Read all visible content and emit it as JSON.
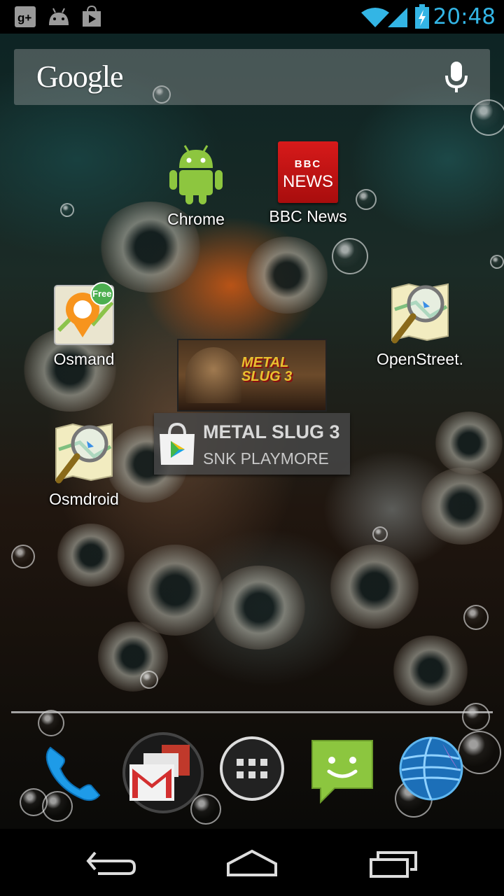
{
  "status_bar": {
    "time": "20:48",
    "left_icons": [
      "google-plus-icon",
      "android-debug-icon",
      "play-store-notification-icon"
    ],
    "right_icons": [
      "wifi-icon",
      "signal-icon",
      "battery-charging-icon"
    ],
    "accent_color": "#33b5e5"
  },
  "search": {
    "logo": "Google",
    "voice_icon": "mic-icon"
  },
  "apps": {
    "chrome": {
      "label": "Chrome",
      "icon": "android-robot-icon"
    },
    "bbc": {
      "label": "BBC News",
      "icon": "bbc-news-icon",
      "icon_top": "BBC",
      "icon_bottom": "NEWS"
    },
    "osmand": {
      "label": "Osmand",
      "icon": "osmand-map-icon",
      "badge": "Free"
    },
    "openstreet": {
      "label": "OpenStreet.",
      "icon": "map-magnifier-icon"
    },
    "osmdroid": {
      "label": "Osmdroid",
      "icon": "map-magnifier-icon"
    }
  },
  "play_widget": {
    "title": "METAL SLUG 3",
    "publisher": "SNK PLAYMORE",
    "art_text": "METAL SLUG 3",
    "icon": "play-store-bag-icon"
  },
  "dock": {
    "items": [
      "phone-icon",
      "gmail-folder-icon",
      "app-drawer-icon",
      "messaging-icon",
      "browser-globe-icon"
    ]
  },
  "nav": {
    "buttons": [
      "back-icon",
      "home-icon",
      "recents-icon"
    ]
  }
}
